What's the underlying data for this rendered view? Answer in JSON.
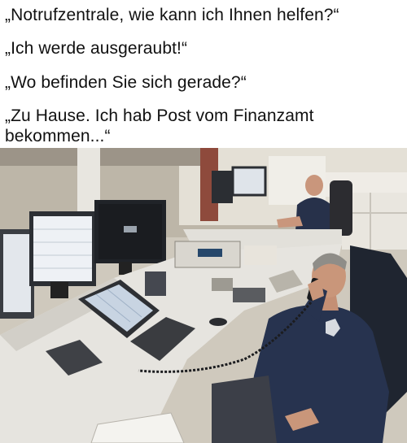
{
  "caption": {
    "line1": "„Notrufzentrale, wie kann ich Ihnen helfen?“",
    "line2": "„Ich werde ausgeraubt!“",
    "line3": "„Wo befinden Sie sich gerade?“",
    "line4a": "„Zu Hause. Ich hab Post vom Finanzamt",
    "line4b": "bekommen...“"
  },
  "photo": {
    "subject": "emergency-dispatch-operator-photo"
  }
}
